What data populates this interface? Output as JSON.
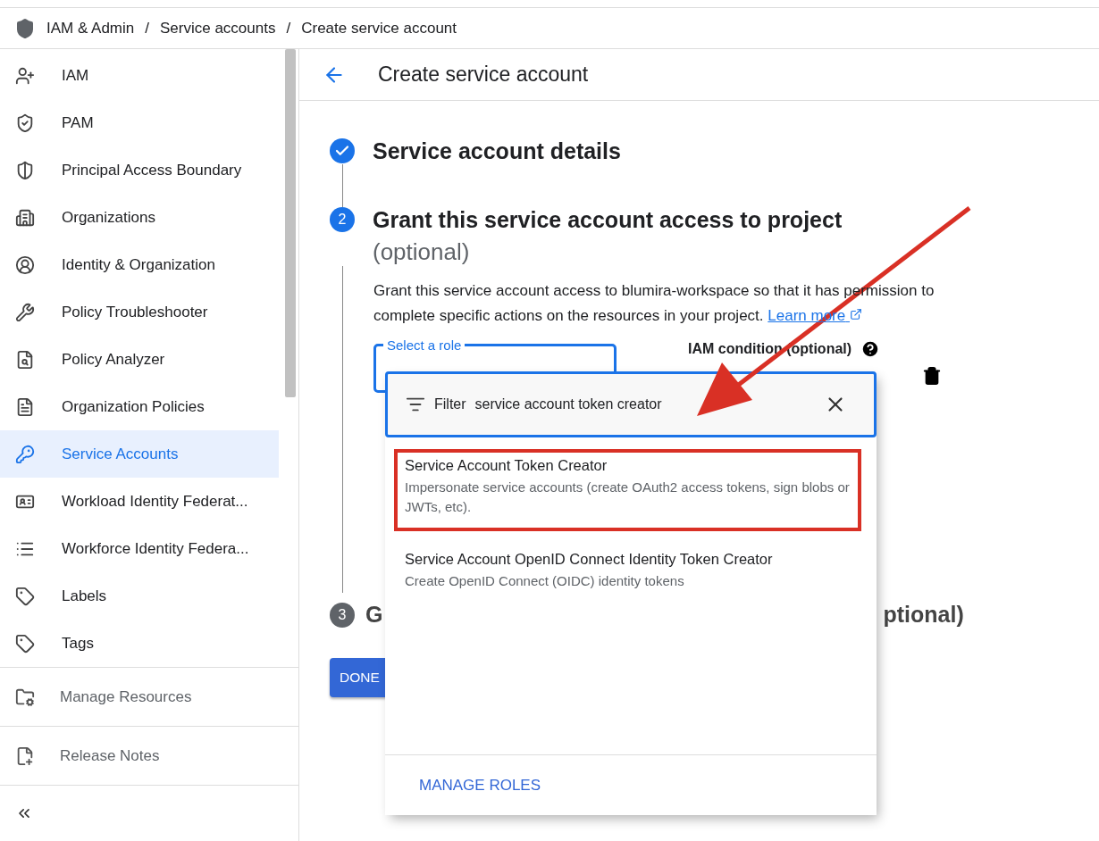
{
  "breadcrumb": [
    "IAM & Admin",
    "Service accounts",
    "Create service account"
  ],
  "breadcrumb_separator": "/",
  "sidebar": {
    "items": [
      {
        "label": "IAM",
        "selected": false
      },
      {
        "label": "PAM",
        "selected": false
      },
      {
        "label": "Principal Access Boundary",
        "selected": false
      },
      {
        "label": "Organizations",
        "selected": false
      },
      {
        "label": "Identity & Organization",
        "selected": false
      },
      {
        "label": "Policy Troubleshooter",
        "selected": false
      },
      {
        "label": "Policy Analyzer",
        "selected": false
      },
      {
        "label": "Organization Policies",
        "selected": false
      },
      {
        "label": "Service Accounts",
        "selected": true
      },
      {
        "label": "Workload Identity Federat...",
        "selected": false
      },
      {
        "label": "Workforce Identity Federa...",
        "selected": false
      },
      {
        "label": "Labels",
        "selected": false
      },
      {
        "label": "Tags",
        "selected": false
      }
    ],
    "footer_items": [
      "Manage Resources",
      "Release Notes"
    ]
  },
  "page_title": "Create service account",
  "steps": [
    {
      "done": true,
      "title": "Service account details"
    },
    {
      "number": "2",
      "active": true,
      "title": "Grant this service account access to project",
      "subtitle": "(optional)",
      "description": "Grant this service account access to blumira-workspace so that it has permission to complete specific actions on the resources in your project.",
      "link": "Learn more"
    },
    {
      "number": "3",
      "active": false,
      "title_start": "G",
      "title_end": "ptional)"
    }
  ],
  "role_field": {
    "label": "Select a role"
  },
  "condition_label": "IAM condition (optional)",
  "done_button": "DONE",
  "dropdown": {
    "filter_label": "Filter",
    "filter_value": "service account token creator",
    "options": [
      {
        "title": "Service Account Token Creator",
        "description": "Impersonate service accounts (create OAuth2 access tokens, sign blobs or JWTs, etc).",
        "highlighted": true
      },
      {
        "title": "Service Account OpenID Connect Identity Token Creator",
        "description": "Create OpenID Connect (OIDC) identity tokens",
        "highlighted": false
      }
    ],
    "footer_link": "MANAGE ROLES"
  }
}
